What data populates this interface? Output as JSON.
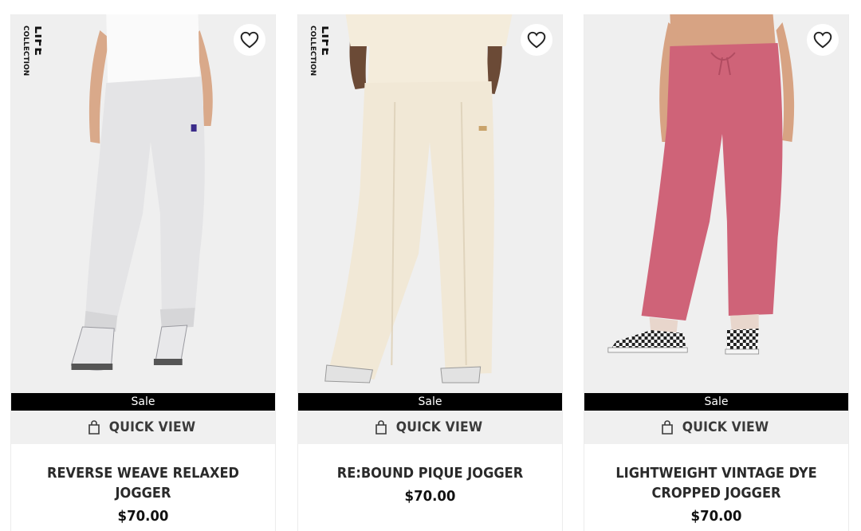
{
  "products": [
    {
      "badge": "LIFE COLLECTION",
      "sale_label": "Sale",
      "quick_view_label": "QUICK VIEW",
      "name": "REVERSE WEAVE RELAXED JOGGER",
      "price": "$70.00",
      "icon_favorite": "heart-outline-icon",
      "icon_quick_view": "shopping-bag-icon",
      "colors": {
        "pant": "#e6e6e8",
        "top": "#fafafa",
        "skin": "#d9a98a",
        "shoe": "#e8e8ea"
      }
    },
    {
      "badge": "LIFE COLLECTION",
      "sale_label": "Sale",
      "quick_view_label": "QUICK VIEW",
      "name": "RE:BOUND PIQUE JOGGER",
      "price": "$70.00",
      "icon_favorite": "heart-outline-icon",
      "icon_quick_view": "shopping-bag-icon",
      "colors": {
        "pant": "#f1e8d6",
        "top": "#f1e8d6",
        "skin": "#6b4a36",
        "shoe": "#e6e6e6"
      }
    },
    {
      "badge": "",
      "sale_label": "Sale",
      "quick_view_label": "QUICK VIEW",
      "name": "LIGHTWEIGHT VINTAGE DYE CROPPED JOGGER",
      "price": "$70.00",
      "icon_favorite": "heart-outline-icon",
      "icon_quick_view": "shopping-bag-icon",
      "colors": {
        "pant": "#cf6378",
        "top": "#ffffff",
        "skin": "#d7a383",
        "shoe": "#222222"
      }
    }
  ],
  "theme": {
    "sale_bg": "#000000",
    "quick_view_bg": "#f0f0f0"
  }
}
